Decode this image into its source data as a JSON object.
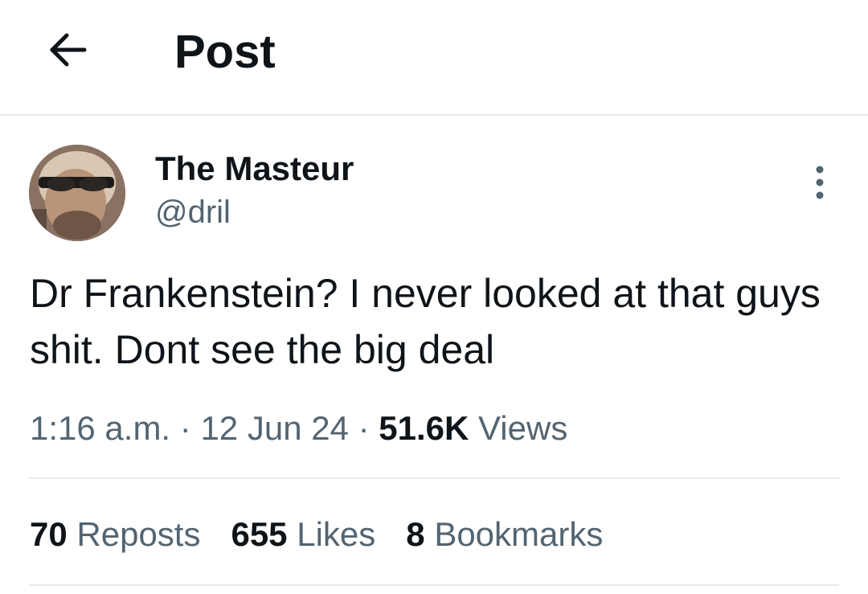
{
  "header": {
    "title": "Post",
    "back_icon": "arrow-left-icon"
  },
  "post": {
    "author": {
      "name": "The Masteur",
      "handle": "@dril",
      "avatar": "avatar-photo"
    },
    "more_icon": "more-vertical-icon",
    "text": "Dr Frankenstein? I never looked at that guys shit. Dont see the big deal",
    "time": "1:16 a.m.",
    "separator": "·",
    "date": "12 Jun 24",
    "views_count": "51.6K",
    "views_label": "Views"
  },
  "stats": [
    {
      "count": "70",
      "label": "Reposts"
    },
    {
      "count": "655",
      "label": "Likes"
    },
    {
      "count": "8",
      "label": "Bookmarks"
    }
  ],
  "colors": {
    "text_primary": "#0f1419",
    "text_secondary": "#536471",
    "divider": "#e7e9ea"
  }
}
